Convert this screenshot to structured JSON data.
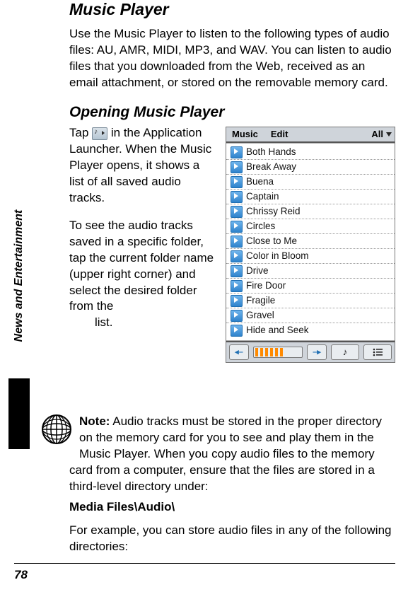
{
  "title": "Music Player",
  "intro": "Use the Music Player to listen to the following types of audio files: AU, AMR, MIDI, MP3, and WAV. You can listen to audio files that you downloaded from the Web, received as an email attachment, or stored on the removable memory card.",
  "subtitle": "Opening Music Player",
  "opening": {
    "pre": "Tap ",
    "post1": " in the Application Launcher. When the Music Player opens, it shows a list of all saved audio tracks.",
    "para2": "To see the audio tracks saved in a specific folder, tap the current folder name (upper right corner) and select the desired folder from the",
    "para2_tail": "list."
  },
  "note": {
    "lead": "Note:",
    "body": " Audio tracks must be stored in the proper directory on the memory card for you to see and play them in the Music Player. When you copy audio files to the memory card from a computer, ensure that the files are stored in a third-level directory under:"
  },
  "path": "Media Files\\Audio\\",
  "example": "For example, you can store audio files in any of the following directories:",
  "screenshot": {
    "menu": {
      "music": "Music",
      "edit": "Edit",
      "folder": "All"
    },
    "tracks": [
      "Both Hands",
      "Break Away",
      "Buena",
      "Captain",
      "Chrissy Reid",
      "Circles",
      "Close to Me",
      "Color in Bloom",
      "Drive",
      "Fire Door",
      "Fragile",
      "Gravel",
      "Hide and Seek"
    ]
  },
  "side_tab": "News and Entertainment",
  "page_number": "78"
}
